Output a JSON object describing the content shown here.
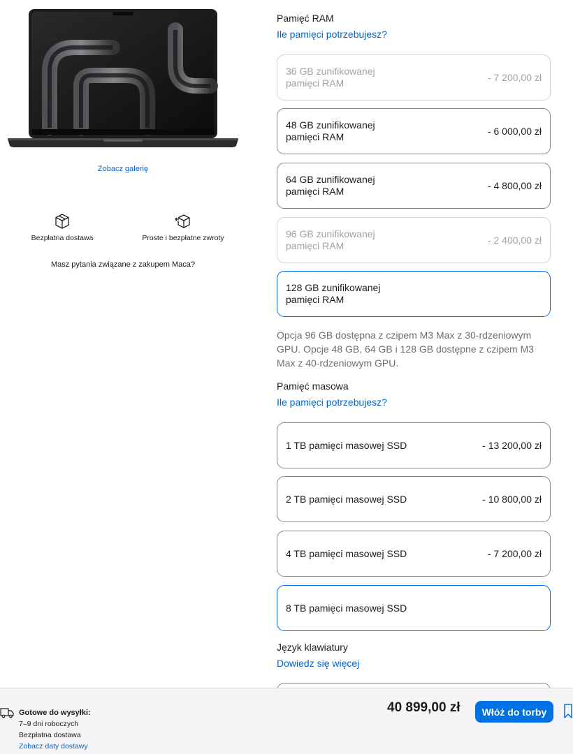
{
  "left": {
    "gallery_link": "Zobacz galerię",
    "perks": [
      {
        "icon": "box-icon",
        "label": "Bezpłatna dostawa"
      },
      {
        "icon": "box-return-icon",
        "label": "Proste i bezpłatne zwroty"
      }
    ],
    "question": "Masz pytania związane z zakupem Maca?"
  },
  "ram": {
    "title": "Pamięć RAM",
    "help_link": "Ile pamięci potrzebujesz?",
    "options": [
      {
        "line1": "36 GB zunifikowanej",
        "line2": "pamięci RAM",
        "price": "- 7 200,00 zł",
        "state": "disabled"
      },
      {
        "line1": "48 GB zunifikowanej",
        "line2": "pamięci RAM",
        "price": "- 6 000,00 zł",
        "state": "enabled"
      },
      {
        "line1": "64 GB zunifikowanej",
        "line2": "pamięci RAM",
        "price": "- 4 800,00 zł",
        "state": "enabled"
      },
      {
        "line1": "96 GB zunifikowanej",
        "line2": "pamięci RAM",
        "price": "- 2 400,00 zł",
        "state": "disabled"
      },
      {
        "line1": "128 GB zunifikowanej",
        "line2": "pamięci RAM",
        "price": "",
        "state": "selected"
      }
    ],
    "note": "Opcja 96 GB dostępna z czipem M3 Max z 30-rdzeniowym GPU. Opcje 48 GB, 64 GB i 128 GB dostępne z czipem M3 Max z 40-rdzeniowym GPU."
  },
  "storage": {
    "title": "Pamięć masowa",
    "help_link": "Ile pamięci potrzebujesz?",
    "options": [
      {
        "label": "1 TB pamięci masowej SSD",
        "price": "- 13 200,00 zł",
        "state": "enabled"
      },
      {
        "label": "2 TB pamięci masowej SSD",
        "price": "- 10 800,00 zł",
        "state": "enabled"
      },
      {
        "label": "4 TB pamięci masowej SSD",
        "price": "- 7 200,00 zł",
        "state": "enabled"
      },
      {
        "label": "8 TB pamięci masowej SSD",
        "price": "",
        "state": "selected"
      }
    ]
  },
  "keyboard": {
    "title": "Język klawiatury",
    "help_link": "Dowiedz się więcej"
  },
  "bottom_bar": {
    "ship_title": "Gotowe do wysyłki:",
    "ship_time": "7–9 dni roboczych",
    "ship_free": "Bezpłatna dostawa",
    "ship_link": "Zobacz daty dostawy",
    "total": "40 899,00 zł",
    "buy_label": "Włóż do torby"
  },
  "colors": {
    "accent": "#0071e3",
    "link": "#0066cc",
    "border": "#86868b",
    "disabled": "#a1a1a6"
  }
}
